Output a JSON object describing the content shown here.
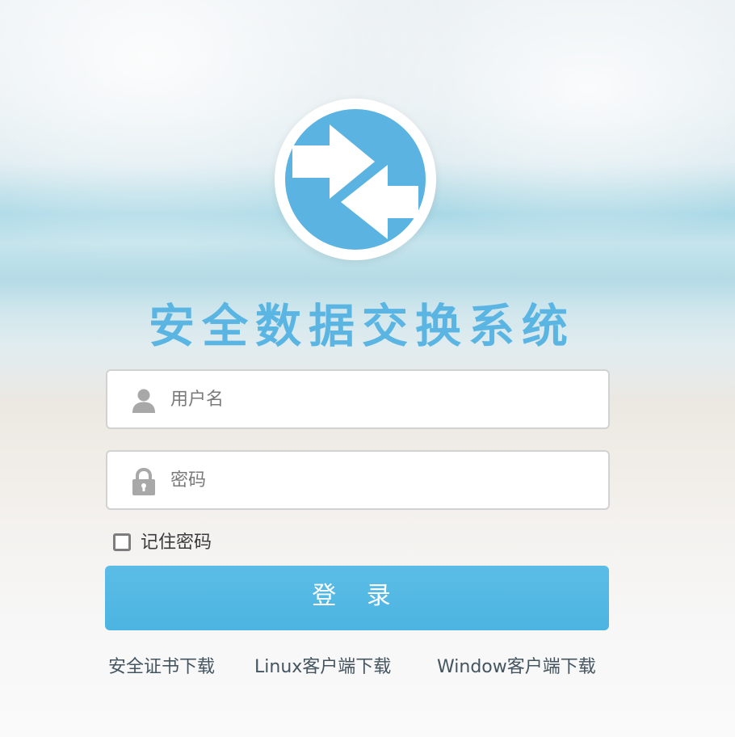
{
  "app": {
    "title": "安全数据交换系统"
  },
  "logo": {
    "icon": "exchange-arrows-icon",
    "colors": {
      "circle": "#5ab3e0",
      "ring": "#ffffff",
      "arrows": "#ffffff"
    }
  },
  "form": {
    "username": {
      "placeholder": "用户名",
      "value": "",
      "icon": "user-icon"
    },
    "password": {
      "placeholder": "密码",
      "value": "",
      "icon": "lock-icon"
    },
    "remember": {
      "label": "记住密码",
      "checked": false
    },
    "submit_label": "登 录"
  },
  "links": {
    "cert": "安全证书下载",
    "linux": "Linux客户端下载",
    "windows": "Window客户端下载"
  },
  "colors": {
    "accent": "#5ab5e3",
    "button": "#52b8e4",
    "link": "#445560"
  }
}
